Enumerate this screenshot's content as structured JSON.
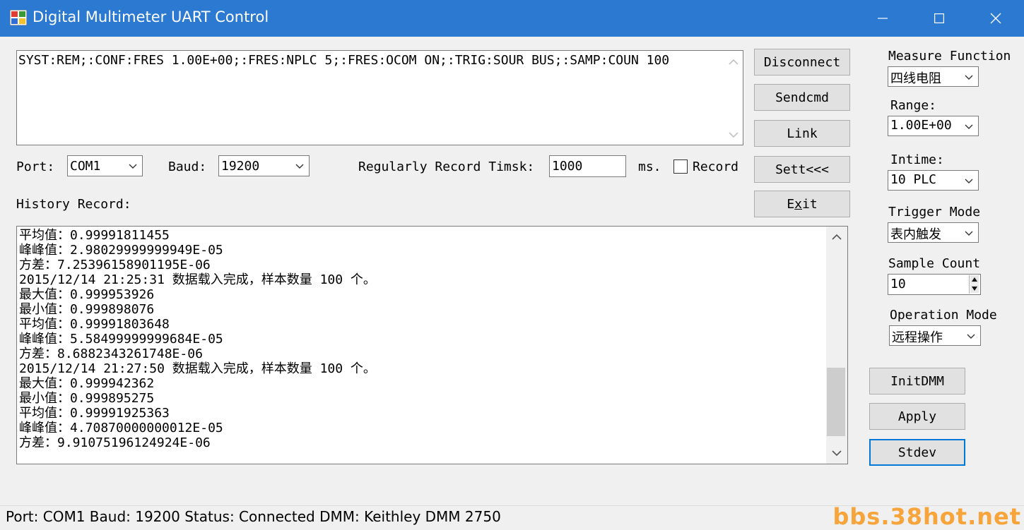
{
  "window": {
    "title": "Digital Multimeter UART Control",
    "title_bar_color": "#2b79d0",
    "accent_color": "#0078d7"
  },
  "command_box": {
    "value": "SYST:REM;:CONF:FRES 1.00E+00;:FRES:NPLC 5;:FRES:OCOM ON;:TRIG:SOUR BUS;:SAMP:COUN 100"
  },
  "buttons": {
    "disconnect": "Disconnect",
    "sendcmd": "Sendcmd",
    "link": "Link",
    "sett": "Sett<<<",
    "exit_prefix": "E",
    "exit_mnemonic": "x",
    "exit_suffix": "it",
    "initdmm": "InitDMM",
    "apply": "Apply",
    "stdev": "Stdev"
  },
  "settings_row": {
    "port_label": "Port:",
    "port_value": "COM1",
    "baud_label": "Baud:",
    "baud_value": "19200",
    "timsk_label": "Regularly Record Timsk:",
    "timsk_value": "1000",
    "ms_label": "ms.",
    "record_label": "Record",
    "record_checked": false
  },
  "history": {
    "label": "History Record:",
    "lines": [
      "平均值：0.99991811455",
      "峰峰值：2.98029999999949E-05",
      "方差：7.25396158901195E-06",
      "2015/12/14 21:25:31 数据载入完成，样本数量 100 个。",
      "最大值：0.999953926",
      "最小值：0.999898076",
      "平均值：0.99991803648",
      "峰峰值：5.58499999999684E-05",
      "方差：8.6882343261748E-06",
      "2015/12/14 21:27:50 数据载入完成，样本数量 100 个。",
      "最大值：0.999942362",
      "最小值：0.999895275",
      "平均值：0.99991925363",
      "峰峰值：4.70870000000012E-05",
      "方差：9.91075196124924E-06"
    ]
  },
  "right_panel": {
    "measure_function_label": "Measure Function",
    "measure_function_value": "四线电阻",
    "range_label": "Range:",
    "range_value": "1.00E+00",
    "intime_label": "Intime:",
    "intime_value": "10 PLC",
    "trigger_mode_label": "Trigger Mode",
    "trigger_mode_value": "表内触发",
    "sample_count_label": "Sample Count",
    "sample_count_value": "10",
    "operation_mode_label": "Operation Mode",
    "operation_mode_value": "远程操作"
  },
  "status_bar": {
    "text": "Port: COM1  Baud: 19200  Status: Connected  DMM: Keithley DMM 2750",
    "watermark": "bbs.38hot.net",
    "watermark_color": "#f7a43a"
  }
}
